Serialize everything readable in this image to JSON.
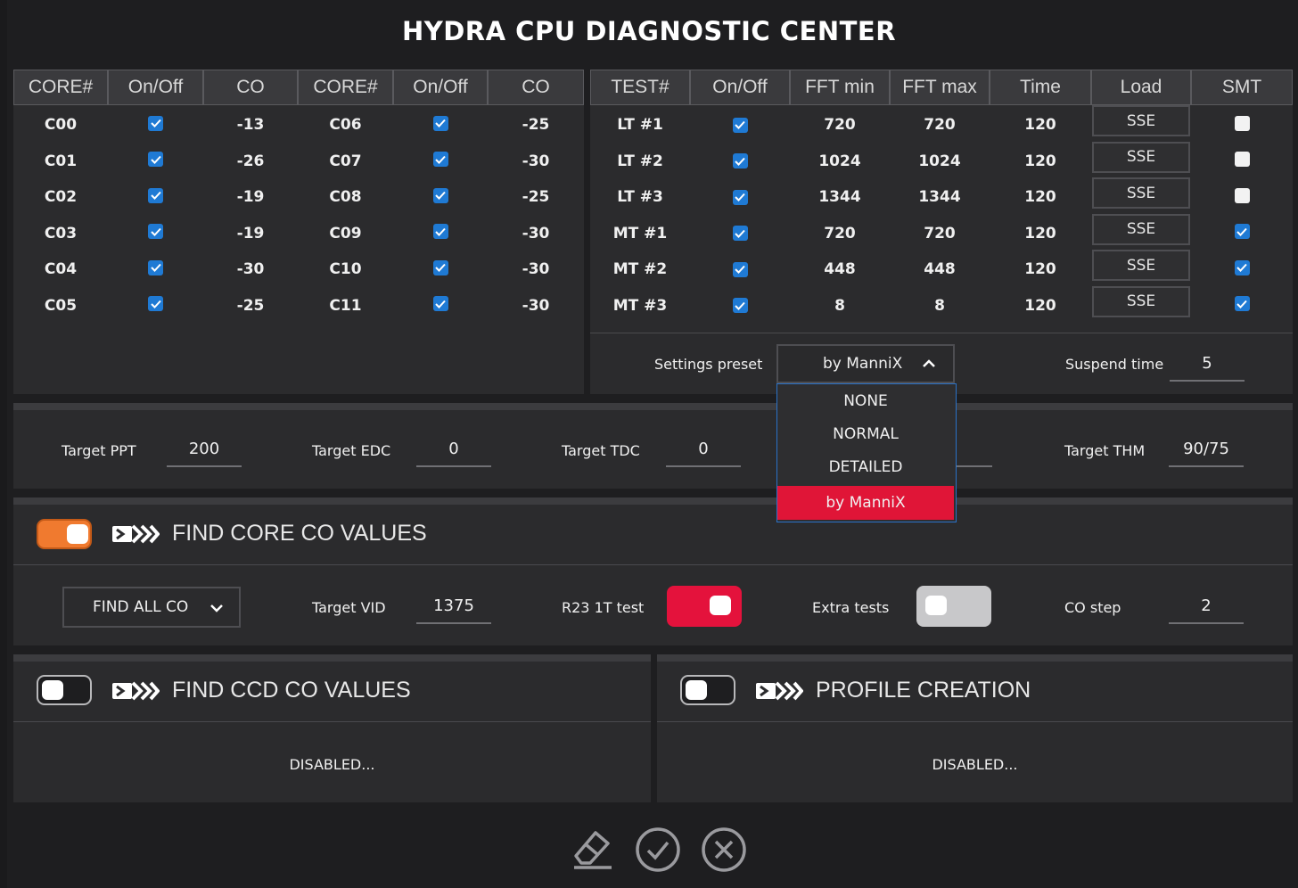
{
  "title": "HYDRA CPU DIAGNOSTIC CENTER",
  "core_table": {
    "headers": [
      "CORE#",
      "On/Off",
      "CO",
      "CORE#",
      "On/Off",
      "CO"
    ],
    "left": [
      {
        "core": "C00",
        "on": true,
        "co": "-13"
      },
      {
        "core": "C01",
        "on": true,
        "co": "-26"
      },
      {
        "core": "C02",
        "on": true,
        "co": "-19"
      },
      {
        "core": "C03",
        "on": true,
        "co": "-19"
      },
      {
        "core": "C04",
        "on": true,
        "co": "-30"
      },
      {
        "core": "C05",
        "on": true,
        "co": "-25"
      }
    ],
    "right": [
      {
        "core": "C06",
        "on": true,
        "co": "-25"
      },
      {
        "core": "C07",
        "on": true,
        "co": "-30"
      },
      {
        "core": "C08",
        "on": true,
        "co": "-25"
      },
      {
        "core": "C09",
        "on": true,
        "co": "-30"
      },
      {
        "core": "C10",
        "on": true,
        "co": "-30"
      },
      {
        "core": "C11",
        "on": true,
        "co": "-30"
      }
    ]
  },
  "test_table": {
    "headers": [
      "TEST#",
      "On/Off",
      "FFT min",
      "FFT max",
      "Time",
      "Load",
      "SMT"
    ],
    "rows": [
      {
        "test": "LT #1",
        "on": true,
        "fft_min": "720",
        "fft_max": "720",
        "time": "120",
        "load": "SSE",
        "smt": false
      },
      {
        "test": "LT #2",
        "on": true,
        "fft_min": "1024",
        "fft_max": "1024",
        "time": "120",
        "load": "SSE",
        "smt": false
      },
      {
        "test": "LT #3",
        "on": true,
        "fft_min": "1344",
        "fft_max": "1344",
        "time": "120",
        "load": "SSE",
        "smt": false
      },
      {
        "test": "MT #1",
        "on": true,
        "fft_min": "720",
        "fft_max": "720",
        "time": "120",
        "load": "SSE",
        "smt": true
      },
      {
        "test": "MT #2",
        "on": true,
        "fft_min": "448",
        "fft_max": "448",
        "time": "120",
        "load": "SSE",
        "smt": true
      },
      {
        "test": "MT #3",
        "on": true,
        "fft_min": "8",
        "fft_max": "8",
        "time": "120",
        "load": "SSE",
        "smt": true
      }
    ]
  },
  "settings": {
    "preset_label": "Settings preset",
    "preset_value": "by ManniX",
    "preset_options": [
      "NONE",
      "NORMAL",
      "DETAILED",
      "by ManniX"
    ],
    "suspend_label": "Suspend time",
    "suspend_value": "5"
  },
  "targets": {
    "ppt_label": "Target PPT",
    "ppt_value": "200",
    "edc_label": "Target EDC",
    "edc_value": "0",
    "tdc_label": "Target TDC",
    "tdc_value": "0",
    "thm_label": "Target THM",
    "thm_value": "90/75"
  },
  "find_core": {
    "enabled": true,
    "title": "FIND CORE CO VALUES",
    "mode": "FIND ALL CO",
    "vid_label": "Target VID",
    "vid_value": "1375",
    "r23_label": "R23 1T test",
    "r23_enabled": true,
    "extra_label": "Extra tests",
    "extra_enabled": false,
    "step_label": "CO step",
    "step_value": "2"
  },
  "find_ccd": {
    "enabled": false,
    "title": "FIND CCD CO VALUES",
    "status": "DISABLED..."
  },
  "profile": {
    "enabled": false,
    "title": "PROFILE CREATION",
    "status": "DISABLED..."
  },
  "footer_icons": [
    "eraser-icon",
    "check-circle-icon",
    "close-circle-icon"
  ],
  "colors": {
    "accent_orange": "#f07a2f",
    "accent_red": "#e4123c",
    "check_blue": "#1f7ad4",
    "select_red": "#e01537"
  }
}
